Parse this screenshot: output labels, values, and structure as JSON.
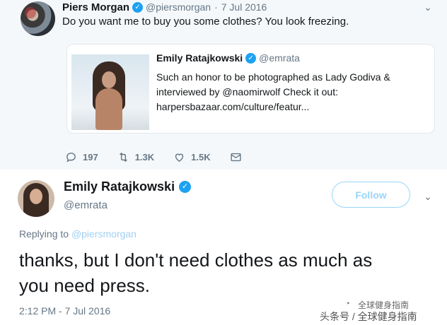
{
  "top_tweet": {
    "author_name": "Piers Morgan",
    "handle": "@piersmorgan",
    "separator": "·",
    "date": "7 Jul 2016",
    "text": "Do you want me to buy you some clothes? You look freezing.",
    "quoted": {
      "author_name": "Emily Ratajkowski",
      "handle": "@emrata",
      "lines": [
        "Such an honor to be photographed as Lady Godiva &",
        "interviewed by @naomirwolf Check it out:",
        "harpersbazaar.com/culture/featur..."
      ]
    },
    "actions": {
      "replies": "197",
      "retweets": "1.3K",
      "likes": "1.5K"
    }
  },
  "reply_tweet": {
    "author_name": "Emily Ratajkowski",
    "handle": "@emrata",
    "follow_label": "Follow",
    "replying_label": "Replying to",
    "replying_handle": "@piersmorgan",
    "text_lines": [
      "thanks, but I don't need clothes as much as",
      "you need press."
    ],
    "timestamp": "2:12 PM - 7 Jul 2016"
  },
  "watermark": {
    "top": "全球健身指南",
    "bottom": "头条号 / 全球健身指南"
  },
  "icons": {
    "verified": "verified-badge-icon",
    "reply": "reply-icon",
    "retweet": "retweet-icon",
    "like": "heart-icon",
    "message": "envelope-icon",
    "menu": "chevron-down-icon"
  },
  "colors": {
    "accent": "#1da1f2",
    "secondary_text": "#657786",
    "top_background": "#f5f8fa"
  }
}
